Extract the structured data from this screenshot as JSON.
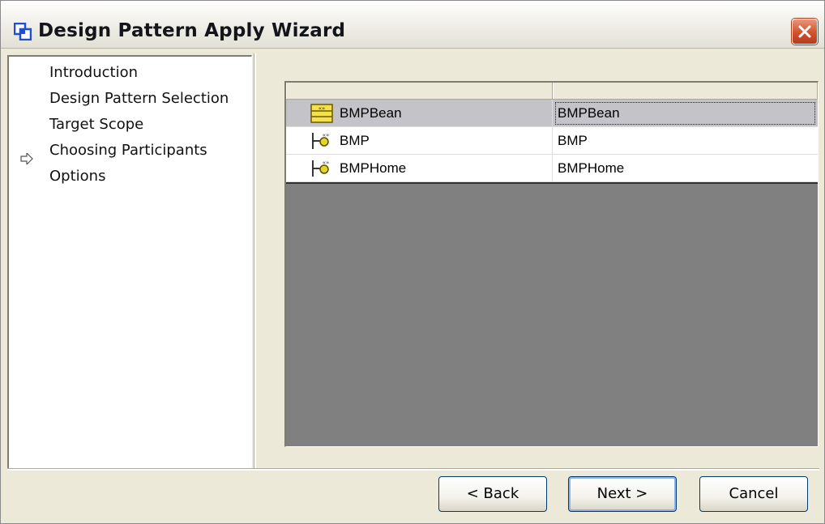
{
  "window": {
    "title": "Design Pattern Apply Wizard"
  },
  "steps": [
    {
      "label": "Introduction",
      "current": false
    },
    {
      "label": "Design Pattern Selection",
      "current": false
    },
    {
      "label": "Target Scope",
      "current": false
    },
    {
      "label": "Choosing Participants",
      "current": true
    },
    {
      "label": "Options",
      "current": false
    }
  ],
  "table": {
    "columns": [
      "",
      ""
    ],
    "rows": [
      {
        "participant": "BMPBean",
        "target": "BMPBean",
        "icon": "class-icon",
        "selected": true
      },
      {
        "participant": "BMP",
        "target": "BMP",
        "icon": "interface-icon",
        "selected": false
      },
      {
        "participant": "BMPHome",
        "target": "BMPHome",
        "icon": "interface-icon",
        "selected": false
      }
    ]
  },
  "buttons": {
    "back": "< Back",
    "next": "Next >",
    "cancel": "Cancel"
  },
  "colors": {
    "title_icon": "#1e4fd0",
    "close_button": "#d0522e",
    "class_icon": "#f5e14a",
    "interface_icon": "#e6d42a"
  }
}
